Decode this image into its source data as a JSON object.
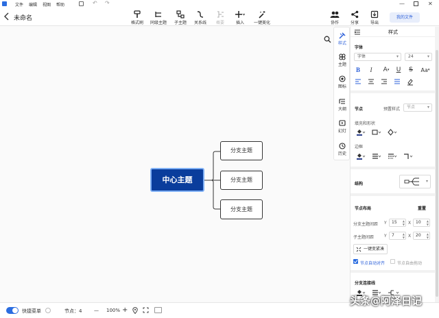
{
  "menubar": {
    "items": [
      "文件",
      "编辑",
      "视图",
      "帮助"
    ]
  },
  "header": {
    "file_title": "未命名",
    "my_file_label": "我的文件"
  },
  "toolbar": {
    "tools": [
      {
        "label": "格式刷",
        "icon": "format-brush-icon"
      },
      {
        "label": "同级主题",
        "icon": "sibling-topic-icon"
      },
      {
        "label": "子主题",
        "icon": "child-topic-icon"
      },
      {
        "label": "关系线",
        "icon": "relation-line-icon"
      },
      {
        "label": "概要",
        "icon": "summary-icon",
        "disabled": true
      },
      {
        "label": "插入",
        "icon": "plus-icon"
      },
      {
        "label": "一键美化",
        "icon": "magic-wand-icon"
      }
    ],
    "right_tools": [
      {
        "label": "协作",
        "icon": "collaborate-icon"
      },
      {
        "label": "分享",
        "icon": "share-icon"
      },
      {
        "label": "导出",
        "icon": "export-icon"
      }
    ]
  },
  "canvas": {
    "center_topic": "中心主题",
    "branch_topics": [
      "分支主题",
      "分支主题",
      "分支主题"
    ],
    "accent": "#0a3d9c"
  },
  "side_tabs": [
    {
      "label": "样式",
      "icon": "style-brush-icon",
      "active": true
    },
    {
      "label": "主题",
      "icon": "theme-icon"
    },
    {
      "label": "图标",
      "icon": "icon-library-icon"
    },
    {
      "label": "大纲",
      "icon": "outline-icon"
    },
    {
      "label": "幻灯",
      "icon": "slideshow-icon"
    },
    {
      "label": "历史",
      "icon": "history-icon"
    }
  ],
  "panel": {
    "title": "样式",
    "font_section": "字体",
    "font_family": "字体",
    "font_size": "24",
    "node_section": "节点",
    "preset_style_label": "预置样式",
    "preset_style_value": "节点",
    "fill_shape_label": "填充和形状",
    "border_label": "边框",
    "structure_label": "结构",
    "layout_section": "节点布局",
    "reset_label": "重置",
    "branch_spacing_label": "分支主题间距",
    "branch_spacing_y": "15",
    "branch_spacing_x": "10",
    "child_spacing_label": "子主题间距",
    "child_spacing_y": "7",
    "child_spacing_x": "20",
    "y_label": "Y",
    "x_label": "X",
    "one_click_label": "一键变紧凑",
    "auto_align_label": "节点自动对齐",
    "free_drag_label": "节点自由拖动",
    "branch_line_section": "分支连接线"
  },
  "status": {
    "quick_menu_label": "快捷菜单",
    "node_count_label": "节点：4",
    "zoom_minus": "—",
    "zoom_level": "100%",
    "zoom_plus": "+"
  },
  "watermark": "头条@阿泽日记"
}
